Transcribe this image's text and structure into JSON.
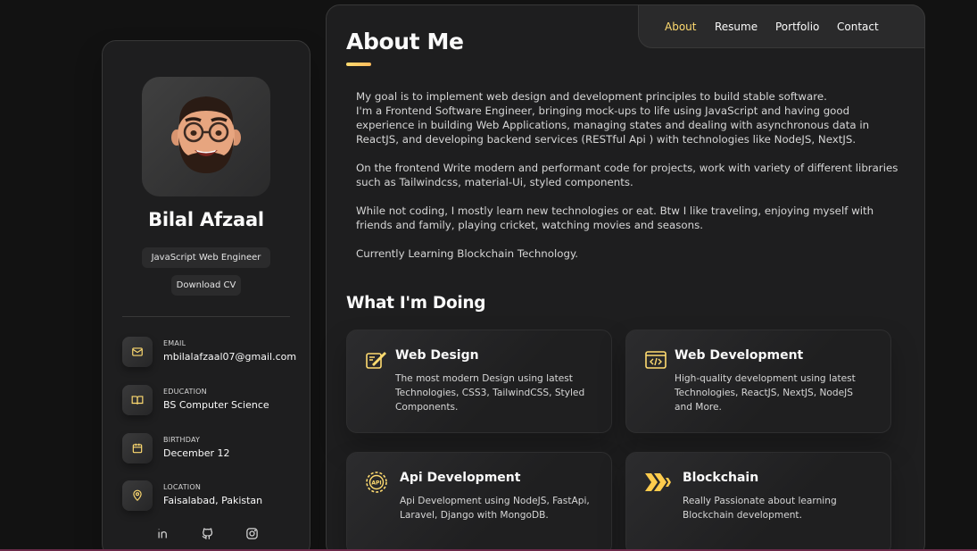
{
  "profile": {
    "name": "Bilal Afzaal",
    "title": "JavaScript Web Engineer",
    "cv_label": "Download CV"
  },
  "contacts": [
    {
      "label": "Email",
      "value": "mbilalafzaal07@gmail.com",
      "icon": "mail-icon"
    },
    {
      "label": "Education",
      "value": "BS Computer Science",
      "icon": "book-icon"
    },
    {
      "label": "Birthday",
      "value": "December 12",
      "icon": "calendar-icon"
    },
    {
      "label": "Location",
      "value": "Faisalabad, Pakistan",
      "icon": "location-icon"
    }
  ],
  "socials": [
    "linkedin-icon",
    "github-icon",
    "instagram-icon"
  ],
  "nav": {
    "items": [
      "About",
      "Resume",
      "Portfolio",
      "Contact"
    ],
    "active": "About"
  },
  "about": {
    "heading": "About Me",
    "paragraphs": [
      "My goal is to implement web design and development principles to build stable software.\nI'm a Frontend Software Engineer, bringing mock-ups to life using JavaScript and having good experience in building Web Applications, managing states and dealing with asynchronous data in ReactJS, and developing backend services (RESTful Api ) with technologies like NodeJS, NextJS.",
      "On the frontend Write modern and performant code for projects, work with variety of different libraries such as Tailwindcss, material-Ui, styled components.",
      "While not coding, I mostly learn new technologies or eat. Btw I like traveling, enjoying myself with friends and family, playing cricket, watching movies and seasons.",
      "Currently Learning Blockchain Technology."
    ]
  },
  "services": {
    "heading": "What I'm Doing",
    "items": [
      {
        "title": "Web Design",
        "desc": "The most modern Design using latest Technologies, CSS3, TailwindCSS, Styled Components.",
        "icon": "design-icon"
      },
      {
        "title": "Web Development",
        "desc": "High-quality development using latest Technologies, ReactJS, NextJS, NodeJS and More.",
        "icon": "code-window-icon"
      },
      {
        "title": "Api Development",
        "desc": "Api Development using NodeJS, FastApi, Laravel, Django with MongoDB.",
        "icon": "api-gear-icon"
      },
      {
        "title": "Blockchain",
        "desc": "Really Passionate about learning Blockchain development.",
        "icon": "blockchain-icon"
      }
    ]
  },
  "colors": {
    "accent": "#ffdb70",
    "background": "#121212",
    "card": "#1e1e1f"
  }
}
